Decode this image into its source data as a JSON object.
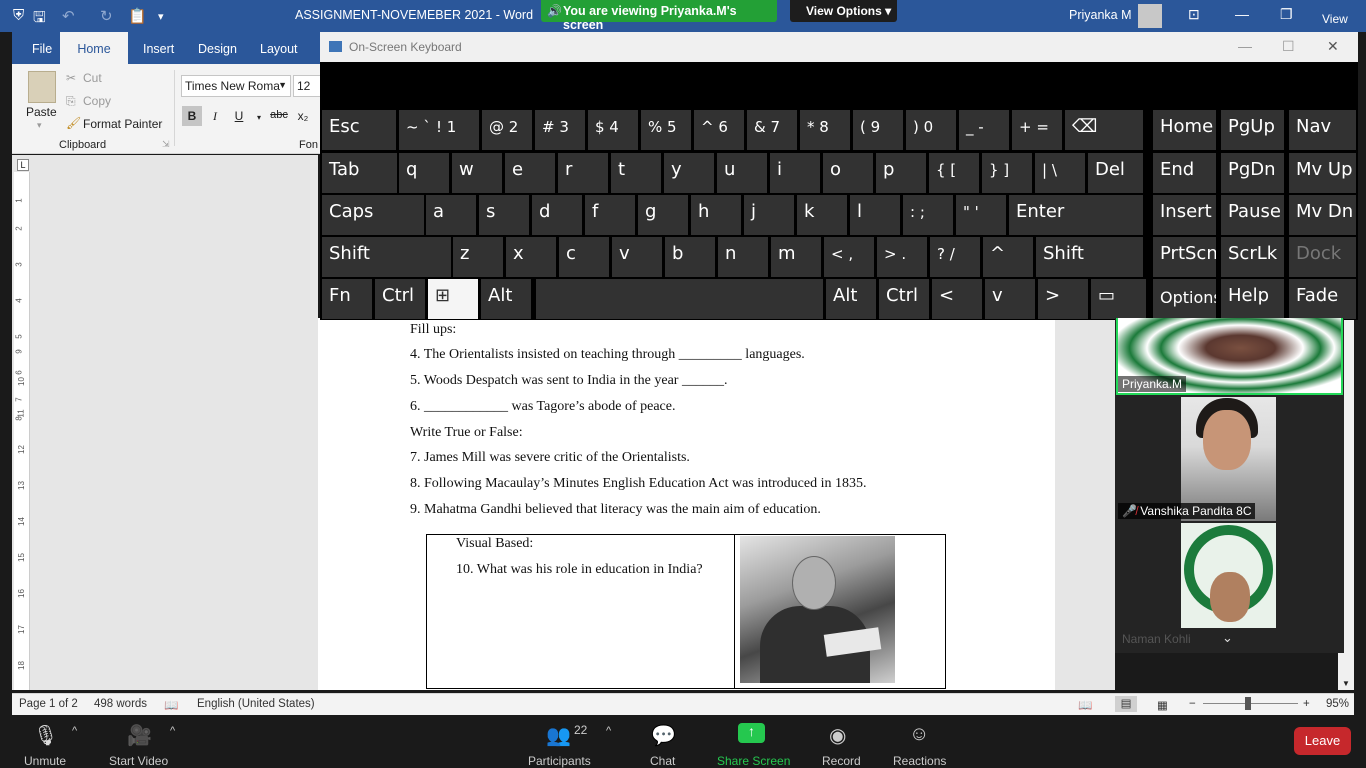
{
  "word": {
    "title": "ASSIGNMENT-NOVEMEBER 2021  -  Word",
    "user": "Priyanka M",
    "tabs": [
      "File",
      "Home",
      "Insert",
      "Design",
      "Layout"
    ],
    "clipboard": {
      "paste": "Paste",
      "cut": "Cut",
      "copy": "Copy",
      "format_painter": "Format Painter",
      "group": "Clipboard"
    },
    "font": {
      "name": "Times New Roma",
      "size": "12",
      "group_partial": "Fon"
    },
    "format_buttons": [
      "B",
      "I",
      "U",
      "abc",
      "x₂"
    ]
  },
  "zoom_meeting": {
    "share_banner": "You are viewing Priyanka.M's screen",
    "view_options": "View Options",
    "view_label": "View",
    "participants": [
      {
        "name": "Priyanka.M",
        "active": true
      },
      {
        "name": "Vanshika Pandita 8C",
        "muted": true
      },
      {
        "name": "Naman Kohli",
        "muted": true
      }
    ],
    "toolbar": {
      "unmute": "Unmute",
      "start_video": "Start Video",
      "participants": "Participants",
      "participants_count": "22",
      "chat": "Chat",
      "share_screen": "Share Screen",
      "record": "Record",
      "reactions": "Reactions",
      "leave": "Leave"
    }
  },
  "document": {
    "lines": [
      "Fill ups:",
      "4.   The Orientalists insisted on teaching through _________ languages.",
      "5.   Woods Despatch was sent to India in the year ______.",
      "6.   ____________ was Tagore’s abode of peace.",
      "Write True or False:",
      "7.   James Mill was severe critic of the Orientalists.",
      "8.   Following Macaulay’s Minutes English Education Act was introduced in 1835.",
      "9.   Mahatma Gandhi believed that literacy was the main aim of education."
    ],
    "table": {
      "heading": "Visual Based:",
      "question": "10. What was his role in education in India?"
    },
    "ruler_numbers": [
      "1",
      "2",
      "3",
      "4",
      "5",
      "6",
      "7",
      "8",
      "9",
      "10",
      "11",
      "12",
      "13",
      "14",
      "15",
      "16",
      "17",
      "18"
    ]
  },
  "status": {
    "page": "Page 1 of 2",
    "words": "498 words",
    "language": "English (United States)",
    "zoom": "95%"
  },
  "osk": {
    "title": "On-Screen Keyboard",
    "rows": [
      [
        "Esc",
        "~ `",
        "! 1",
        "@ 2",
        "# 3",
        "$ 4",
        "% 5",
        "^ 6",
        "& 7",
        "* 8",
        "( 9",
        ") 0",
        "_ -",
        "+ =",
        "⌫",
        "Home",
        "PgUp",
        "Nav"
      ],
      [
        "Tab",
        "q",
        "w",
        "e",
        "r",
        "t",
        "y",
        "u",
        "i",
        "o",
        "p",
        "{ [",
        "} ]",
        "| \\",
        "Del",
        "End",
        "PgDn",
        "Mv Up"
      ],
      [
        "Caps",
        "a",
        "s",
        "d",
        "f",
        "g",
        "h",
        "j",
        "k",
        "l",
        ": ;",
        "\" '",
        "Enter",
        "Insert",
        "Pause",
        "Mv Dn"
      ],
      [
        "Shift",
        "z",
        "x",
        "c",
        "v",
        "b",
        "n",
        "m",
        "< ,",
        "> .",
        "? /",
        "^",
        "Shift",
        "PrtScn",
        "ScrLk",
        "Dock"
      ],
      [
        "Fn",
        "Ctrl",
        "⊞",
        "Alt",
        "",
        "Alt",
        "Ctrl",
        "<",
        "v",
        ">",
        "▭",
        "Options",
        "Help",
        "Fade"
      ]
    ]
  }
}
